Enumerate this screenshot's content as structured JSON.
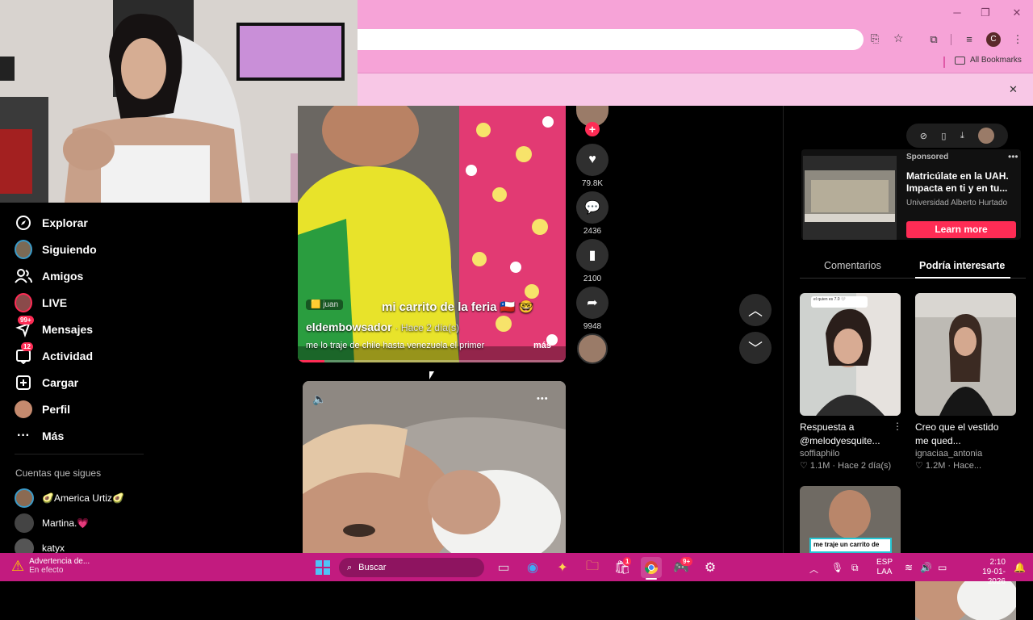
{
  "window": {
    "minimize": "─",
    "restore": "❐",
    "close": "✕"
  },
  "toolbar": {
    "bookmarks_label": "All Bookmarks",
    "profile_initial": "C",
    "infobar_close": "✕"
  },
  "sidebar": {
    "items": [
      {
        "label": "Explorar",
        "icon": "compass-icon"
      },
      {
        "label": "Siguiendo",
        "icon": "following-avatar"
      },
      {
        "label": "Amigos",
        "icon": "friends-icon"
      },
      {
        "label": "LIVE",
        "icon": "live-avatar"
      },
      {
        "label": "Mensajes",
        "icon": "messages-icon",
        "badge": "99+"
      },
      {
        "label": "Actividad",
        "icon": "activity-icon",
        "badge": "12"
      },
      {
        "label": "Cargar",
        "icon": "upload-icon"
      },
      {
        "label": "Perfil",
        "icon": "profile-avatar"
      },
      {
        "label": "Más",
        "icon": "more-icon"
      }
    ],
    "following_heading": "Cuentas que sigues",
    "following": [
      {
        "name": "🥑America Urtiz🥑"
      },
      {
        "name": "Martina.💗"
      },
      {
        "name": "katyx"
      }
    ]
  },
  "video1": {
    "tag": "🟨 juan",
    "caption_overlay": "mi carrito de la feria 🇨🇱 🤓",
    "author": "eldembowsador",
    "time": "· Hace 2 día(s)",
    "description": "me lo traje de chile hasta venezuela el primer",
    "more": "más",
    "progress": 0.1
  },
  "actions": {
    "likes": "79.8K",
    "comments": "2436",
    "saves": "2100",
    "shares": "9948"
  },
  "video2": {
    "volume_icon": "🔈",
    "menu": "•••"
  },
  "right": {
    "sponsored_label": "Sponsored",
    "ad_title": "Matricúlate en la UAH. Impacta en ti y en tu...",
    "ad_advertiser": "Universidad Alberto Hurtado",
    "ad_cta": "Learn more",
    "tabs": [
      "Comentarios",
      "Podría interesarte"
    ],
    "cards": [
      {
        "title": "Respuesta a @melodyesquite...",
        "author": "soffiaphilo",
        "meta": "♡ 1.1M · Hace 2 día(s)",
        "mini_caption": "el quien es 7.0 🤍"
      },
      {
        "title": "Creo que el vestido me qued...",
        "author": "ignaciaa_antonia",
        "meta": "♡ 1.2M · Hace..."
      }
    ],
    "card3_caption": "me traje un carrito de"
  },
  "taskbar": {
    "weather_title": "Advertencia de...",
    "weather_sub": "En efecto",
    "search_placeholder": "Buscar",
    "lang1": "ESP",
    "lang2": "LAA",
    "time": "2:10",
    "date": "19-01-2026",
    "store_badge": "1",
    "discord_badge": "9+"
  },
  "colors": {
    "accent": "#fe2c55",
    "chrome": "#f6a3d7",
    "taskbar": "#c21b7f"
  }
}
